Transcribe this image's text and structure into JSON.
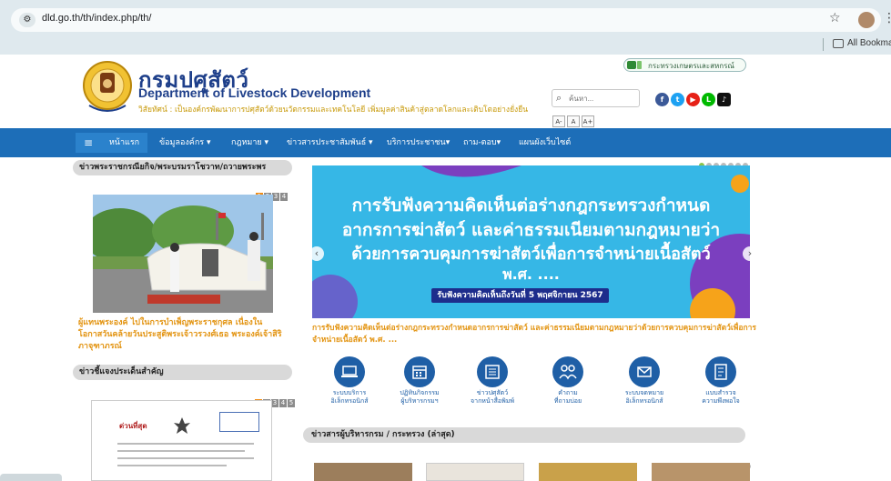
{
  "browser": {
    "url": "dld.go.th/th/index.php/th/",
    "bookmarks_label": "All Bookmarks"
  },
  "header": {
    "title_th": "กรมปศุสัตว์",
    "title_en": "Department of Livestock Development",
    "vision": "วิสัยทัศน์ : เป็นองค์กรพัฒนาการปศุสัตว์ด้วยนวัตกรรมและเทคโนโลยี เพิ่มมูลค่าสินค้าสู่ตลาดโลกและเติบโตอย่างยั่งยืน",
    "ministry": "กระทรวงเกษตรและสหกรณ์",
    "search_placeholder": "ค้นหา...",
    "font_sizes": [
      "A-",
      "A",
      "A+"
    ],
    "social": [
      {
        "name": "facebook",
        "glyph": "f",
        "color": "#3b5998"
      },
      {
        "name": "twitter",
        "glyph": "t",
        "color": "#1da1f2"
      },
      {
        "name": "youtube",
        "glyph": "▶",
        "color": "#e62117"
      },
      {
        "name": "line",
        "glyph": "L",
        "color": "#00b900"
      },
      {
        "name": "tiktok",
        "glyph": "♪",
        "color": "#111111"
      }
    ]
  },
  "nav": {
    "menu_glyph": "≡",
    "items": [
      "หน้าแรก",
      "ข้อมูลองค์กร ▾",
      "กฎหมาย ▾",
      "ข่าวสารประชาสัมพันธ์ ▾",
      "บริการประชาชน▾",
      "ถาม-ตอบ▾",
      "แผนผังเว็บไซต์"
    ]
  },
  "royal_news": {
    "heading": "ข่าวพระราชกรณียกิจ/พระบรมราโชวาท/ถวายพระพร",
    "pages": [
      "1",
      "2",
      "3",
      "4"
    ],
    "caption": "ผู้แทนพระองค์ ไปในการบำเพ็ญพระราชกุศล เนื่องในโอกาสวันคล้ายวันประสูติพระเจ้าวรวงศ์เธอ พระองค์เจ้าสิริภาจุฑาภรณ์"
  },
  "announcements": {
    "heading": "ข่าวชี้แจงประเด็นสำคัญ",
    "pages": [
      "1",
      "2",
      "3",
      "4",
      "5"
    ]
  },
  "banner": {
    "line1": "การรับฟังความคิดเห็นต่อร่างกฎกระทรวงกำหนด",
    "line2": "อากรการฆ่าสัตว์ และค่าธรรมเนียมตามกฎหมายว่า",
    "line3": "ด้วยการควบคุมการฆ่าสัตว์เพื่อการจำหน่ายเนื้อสัตว์",
    "line4": "พ.ศ. ....",
    "deadline": "รับฟังความคิดเห็นถึงวันที่ 5 พฤศจิกายน 2567",
    "caption": "การรับฟังความคิดเห็นต่อร่างกฎกระทรวงกำหนดอากรการฆ่าสัตว์ และค่าธรรมเนียมตามกฎหมายว่าด้วยการควบคุมการฆ่าสัตว์เพื่อการจำหน่ายเนื้อสัตว์ พ.ศ. ...",
    "prev_glyph": "‹",
    "next_glyph": "›"
  },
  "services": [
    {
      "icon": "laptop-icon",
      "label1": "ระบบบริการ",
      "label2": "อิเล็กทรอนิกส์"
    },
    {
      "icon": "calendar-icon",
      "label1": "ปฏิทินกิจกรรม",
      "label2": "ผู้บริหารกรมฯ"
    },
    {
      "icon": "newspaper-icon",
      "label1": "ข่าวปศุสัตว์",
      "label2": "จากหน้าสื่อพิมพ์"
    },
    {
      "icon": "people-icon",
      "label1": "คำถาม",
      "label2": "ที่ถามบ่อย"
    },
    {
      "icon": "mail-icon",
      "label1": "ระบบจดหมาย",
      "label2": "อิเล็กทรอนิกส์"
    },
    {
      "icon": "survey-icon",
      "label1": "แบบสำรวจ",
      "label2": "ความพึงพอใจ"
    }
  ],
  "exec_news": {
    "heading": "ข่าวสารผู้บริหารกรม / กระทรวง (ล่าสุด)"
  },
  "doc_preview": {
    "title": "ด่วนที่สุด"
  }
}
